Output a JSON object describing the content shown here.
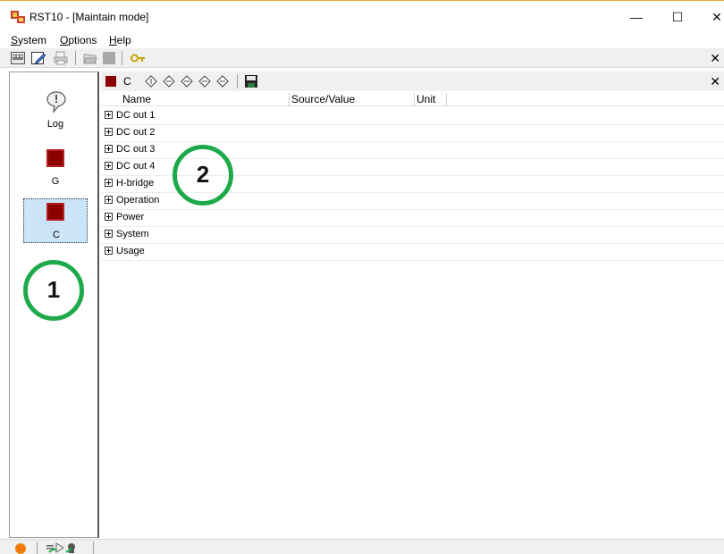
{
  "window": {
    "title": "RST10 - [Maintain mode]",
    "controls": {
      "minimize": "—",
      "maximize": "☐",
      "close": "✕"
    }
  },
  "menu": {
    "items": [
      {
        "label": "System",
        "accel": "S"
      },
      {
        "label": "Options",
        "accel": "O"
      },
      {
        "label": "Help",
        "accel": "H"
      }
    ]
  },
  "toolbar": {
    "icons": [
      "bus-icon",
      "edit-icon",
      "print-icon",
      "open-folder-icon",
      "stop-icon",
      "key-icon"
    ],
    "close_label": "✕"
  },
  "sidebar": {
    "items": [
      {
        "label": "Log",
        "icon": "speech-bubble-icon",
        "selected": false
      },
      {
        "label": "G",
        "icon": "red-square-icon",
        "selected": false
      },
      {
        "label": "C",
        "icon": "red-square-icon",
        "selected": true
      }
    ]
  },
  "subtoolbar": {
    "module_label": "C",
    "icons": [
      "diamond-icon",
      "diamond-icon",
      "diamond-icon",
      "diamond-icon",
      "diamond-icon",
      "save-icon"
    ],
    "close_label": "✕"
  },
  "table": {
    "columns": [
      "Name",
      "Source/Value",
      "Unit"
    ],
    "rows": [
      {
        "label": "DC out 1"
      },
      {
        "label": "DC out 2"
      },
      {
        "label": "DC out 3"
      },
      {
        "label": "DC out 4"
      },
      {
        "label": "H-bridge"
      },
      {
        "label": "Operation"
      },
      {
        "label": "Power"
      },
      {
        "label": "System"
      },
      {
        "label": "Usage"
      }
    ]
  },
  "annotations": {
    "one": "1",
    "two": "2"
  },
  "colors": {
    "accent_red": "#8b0000",
    "annotation_green": "#1eaa4a",
    "selection_blue": "#cce4f7",
    "status_orange": "#f07c11"
  }
}
